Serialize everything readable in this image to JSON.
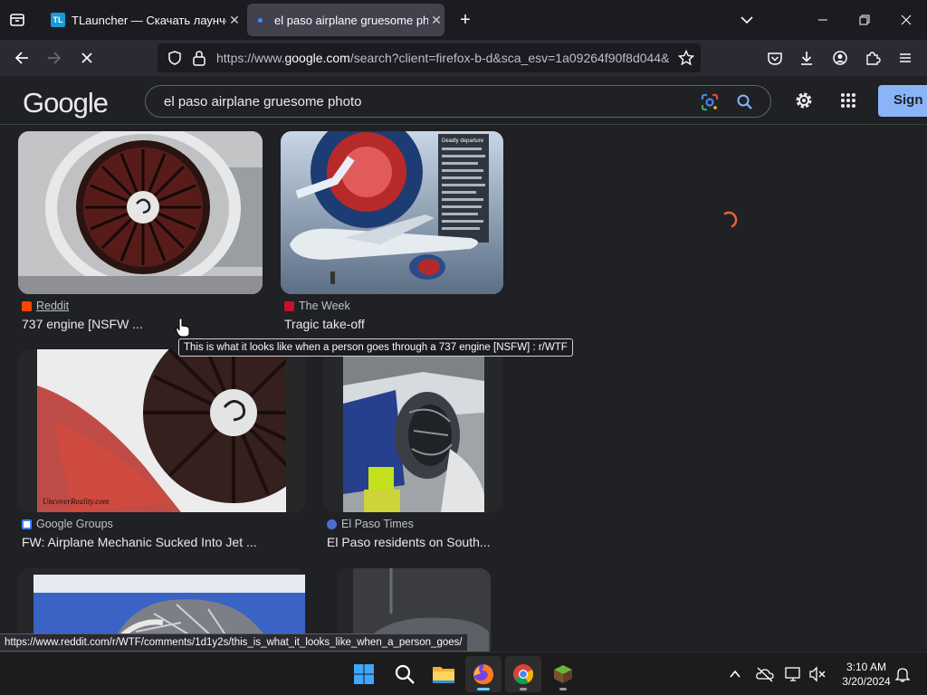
{
  "browser": {
    "tabs": [
      {
        "title": "TLauncher — Скачать лаунчер",
        "favicon_text": "TL"
      },
      {
        "title": "el paso airplane gruesome photo"
      }
    ],
    "url_prefix": "https://www.",
    "url_domain": "google.com",
    "url_rest": "/search?client=firefox-b-d&sca_esv=1a09264f90f8d044&"
  },
  "google": {
    "logo": "Google",
    "query": "el paso airplane gruesome photo",
    "signin_label": "Sign i"
  },
  "results": [
    {
      "source": "Reddit",
      "title": "737 engine [NSFW ..."
    },
    {
      "source": "The Week",
      "title": "Tragic take-off",
      "badge_title": "Deadly departure"
    },
    {
      "source": "Google Groups",
      "title": "FW: Airplane Mechanic Sucked Into Jet ...",
      "watermark": "UncoverReality.com"
    },
    {
      "source": "El Paso Times",
      "title": "El Paso residents on South..."
    }
  ],
  "tooltip": "This is what it looks like when a person goes through a 737 engine [NSFW] : r/WTF",
  "status_url": "https://www.reddit.com/r/WTF/comments/1d1y2s/this_is_what_it_looks_like_when_a_person_goes/",
  "taskbar": {
    "time": "3:10 AM",
    "date": "3/20/2024"
  },
  "colors": {
    "accent": "#8ab4f8",
    "firefox_bar": "#2b2a33",
    "google_bg": "#202124"
  }
}
